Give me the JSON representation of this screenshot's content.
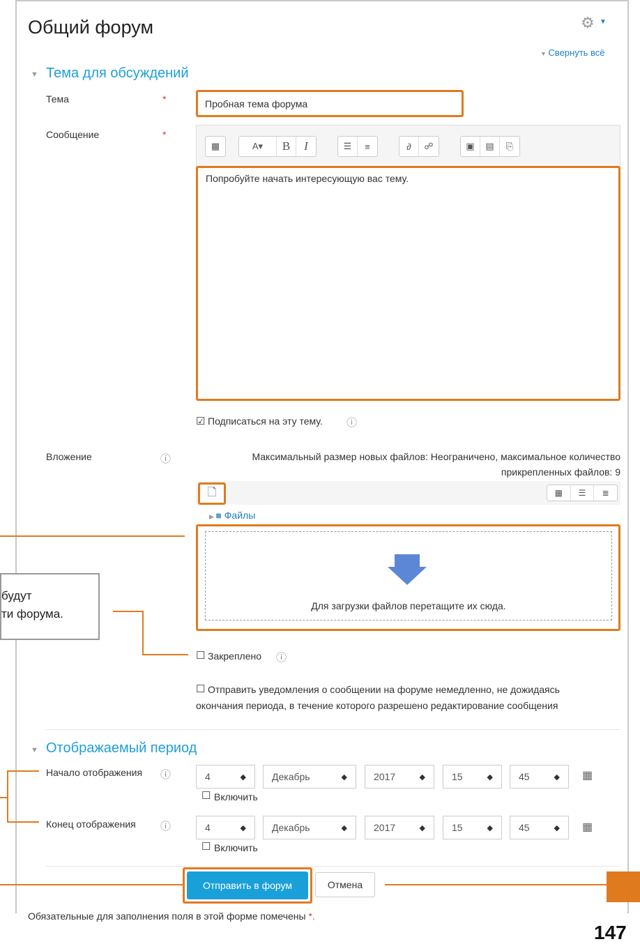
{
  "page": {
    "title": "Общий форум",
    "collapse_all": "Свернуть всё",
    "page_number": "147"
  },
  "sections": {
    "topic": "Тема для обсуждений",
    "period": "Отображаемый период"
  },
  "fields": {
    "subject_label": "Тема",
    "subject_value": "Пробная тема форума",
    "message_label": "Сообщение",
    "message_value": "Попробуйте начать интересующую вас тему.",
    "required_mark": "*",
    "subscribe_label": "Подписаться на эту тему.",
    "attachment_label": "Вложение",
    "attachment_info_line1": "Максимальный размер новых файлов: Неограничено, максимальное количество",
    "attachment_info_line2": "прикрепленных файлов: 9",
    "files_folder": "Файлы",
    "dropzone_text": "Для загрузки файлов перетащите их сюда.",
    "pinned_label": "Закреплено",
    "notify_line1": "Отправить уведомления о сообщении на форуме немедленно, не дожидаясь",
    "notify_line2": "окончания периода, в течение которого разрешено редактирование сообщения"
  },
  "period": {
    "start_label": "Начало отображения",
    "end_label": "Конец отображения",
    "enable_label": "Включить",
    "start": {
      "day": "4",
      "month": "Декабрь",
      "year": "2017",
      "hour": "15",
      "minute": "45"
    },
    "end": {
      "day": "4",
      "month": "Декабрь",
      "year": "2017",
      "hour": "15",
      "minute": "45"
    }
  },
  "buttons": {
    "submit": "Отправить в форум",
    "cancel": "Отмена"
  },
  "callout": {
    "line1": "будут",
    "line2": "ти форума."
  },
  "footer": {
    "required_note": "Обязательные для заполнения поля в этой форме помечены",
    "required_star": "*."
  },
  "colors": {
    "accent_blue": "#1aa0d8",
    "highlight_orange": "#e07a1f",
    "required_red": "#d43c3c"
  }
}
